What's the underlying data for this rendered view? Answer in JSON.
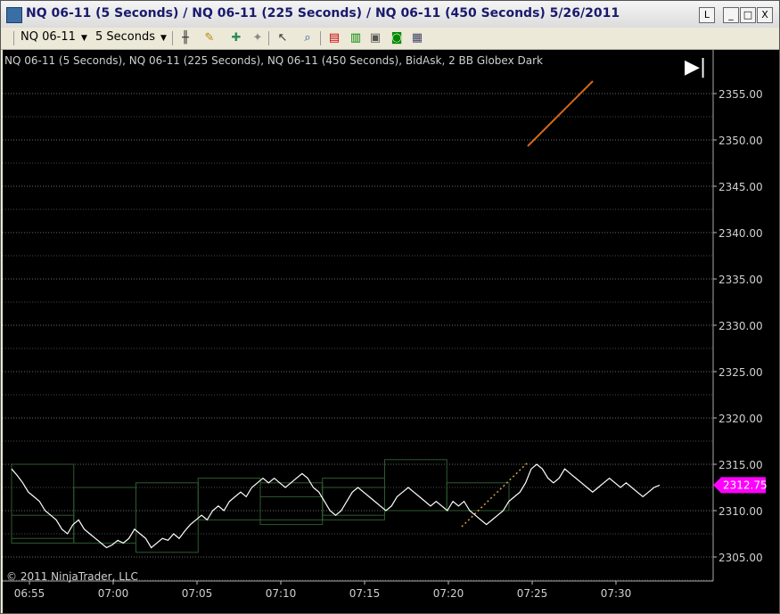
{
  "window": {
    "title": "NQ 06-11 (5 Seconds) / NQ 06-11 (225 Seconds) / NQ 06-11 (450 Seconds)  5/26/2011",
    "controls": [
      "L",
      "_",
      "□",
      "X"
    ]
  },
  "toolbar": {
    "instrument": "NQ 06-11",
    "interval": "5 Seconds",
    "icons": [
      "bar-type-icon",
      "pencil-draw-icon",
      "add-indicator-icon",
      "strategy-icon",
      "pointer-icon",
      "zoom-icon",
      "data-box-icon",
      "properties-icon",
      "chart-template-icon",
      "save-icon",
      "doc-icon"
    ]
  },
  "chart": {
    "header": "NQ 06-11 (5 Seconds), NQ 06-11 (225 Seconds), NQ 06-11 (450 Seconds), BidAsk, 2 BB Globex Dark",
    "copyright": "© 2011 NinjaTrader, LLC",
    "price_marker": "2312.75",
    "colors": {
      "background": "#000000",
      "grid": "#808080",
      "marker": "#ff00ff",
      "trendline": "#d2691e",
      "box": "#2e5a2e"
    }
  },
  "chart_data": {
    "type": "line",
    "x_tick_labels": [
      "06:55",
      "07:00",
      "07:05",
      "07:10",
      "07:15",
      "07:20",
      "07:25",
      "07:30"
    ],
    "y_tick_labels": [
      "2355.00",
      "2350.00",
      "2345.00",
      "2340.00",
      "2335.00",
      "2330.00",
      "2325.00",
      "2320.00",
      "2315.00",
      "2310.00",
      "2305.00"
    ],
    "ylim": [
      2304,
      2359
    ],
    "last_price": 2312.75,
    "series": [
      {
        "values": [
          2314.5,
          2313.8,
          2313.0,
          2312.0,
          2311.5,
          2311.0,
          2310.0,
          2309.5,
          2309.0,
          2308.0,
          2307.5,
          2308.5,
          2309.0,
          2308.0,
          2307.5,
          2307.0,
          2306.5,
          2306.0,
          2306.3,
          2306.8,
          2306.5,
          2307.0,
          2308.0,
          2307.5,
          2307.0,
          2306.0,
          2306.5,
          2307.0,
          2306.8,
          2307.5,
          2307.0,
          2307.8,
          2308.5,
          2309.0,
          2309.5,
          2309.0,
          2310.0,
          2310.5,
          2310.0,
          2311.0,
          2311.5,
          2312.0,
          2311.5,
          2312.5,
          2313.0,
          2313.5,
          2313.0,
          2313.5,
          2313.0,
          2312.5,
          2313.0,
          2313.5,
          2314.0,
          2313.5,
          2312.5,
          2312.0,
          2311.0,
          2310.0,
          2309.5,
          2310.0,
          2311.0,
          2312.0,
          2312.5,
          2312.0,
          2311.5,
          2311.0,
          2310.5,
          2310.0,
          2310.5,
          2311.5,
          2312.0,
          2312.5,
          2312.0,
          2311.5,
          2311.0,
          2310.5,
          2311.0,
          2310.5,
          2310.0,
          2311.0,
          2310.5,
          2311.0,
          2310.0,
          2309.5,
          2309.0,
          2308.5,
          2309.0,
          2309.5,
          2310.0,
          2311.0,
          2311.5,
          2312.0,
          2313.0,
          2314.5,
          2315.0,
          2314.5,
          2313.5,
          2313.0,
          2313.5,
          2314.5,
          2314.0,
          2313.5,
          2313.0,
          2312.5,
          2312.0,
          2312.5,
          2313.0,
          2313.5,
          2313.0,
          2312.5,
          2313.0,
          2312.5,
          2312.0,
          2311.5,
          2312.0,
          2312.5,
          2312.75
        ],
        "x_minutes_start": 0,
        "x_minutes_end": 37.5
      }
    ],
    "boxes_minutes_and_prices": [
      [
        0,
        7.5,
        2306.5,
        2315.0
      ],
      [
        0,
        7.5,
        2307.0,
        2309.5
      ],
      [
        7.5,
        15,
        2306.5,
        2312.5
      ],
      [
        15,
        22.5,
        2305.5,
        2313.0
      ],
      [
        22.5,
        30,
        2309.0,
        2313.5
      ],
      [
        30,
        37.5,
        2308.5,
        2313.0
      ],
      [
        30,
        37.5,
        2309.0,
        2311.5
      ],
      [
        37.5,
        45,
        2309.0,
        2313.5
      ],
      [
        37.5,
        45,
        2309.5,
        2312.5
      ],
      [
        45,
        52.5,
        2310.0,
        2315.5
      ],
      [
        52.5,
        60,
        2310.0,
        2313.0
      ]
    ]
  }
}
